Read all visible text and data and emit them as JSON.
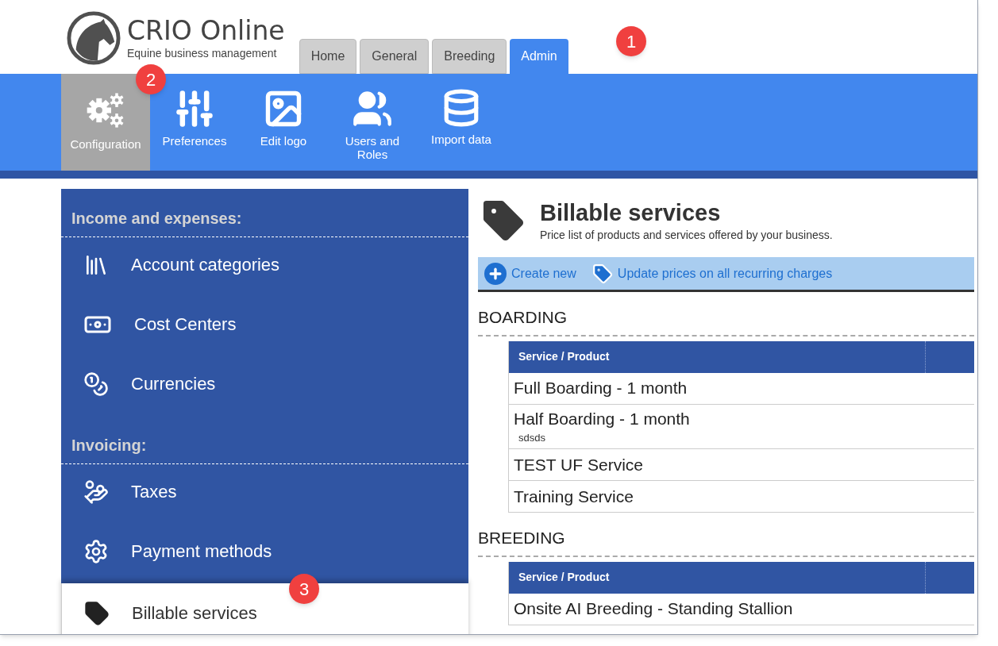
{
  "logo": {
    "title": "CRIO Online",
    "subtitle": "Equine business management"
  },
  "tabs": [
    {
      "label": "Home",
      "selected": false
    },
    {
      "label": "General",
      "selected": false
    },
    {
      "label": "Breeding",
      "selected": false
    },
    {
      "label": "Admin",
      "selected": true
    }
  ],
  "toolbar": [
    {
      "label": "Configuration",
      "selected": true
    },
    {
      "label": "Preferences",
      "selected": false
    },
    {
      "label": "Edit logo",
      "selected": false
    },
    {
      "label": "Users and Roles",
      "selected": false
    },
    {
      "label": "Import data",
      "selected": false
    }
  ],
  "sidebar": {
    "sections": [
      {
        "heading": "Income and expenses:",
        "items": [
          {
            "label": "Account categories",
            "selected": false
          },
          {
            "label": "Cost Centers",
            "selected": false
          },
          {
            "label": "Currencies",
            "selected": false
          }
        ]
      },
      {
        "heading": "Invoicing:",
        "items": [
          {
            "label": "Taxes",
            "selected": false
          },
          {
            "label": "Payment methods",
            "selected": false
          },
          {
            "label": "Billable services",
            "selected": true
          }
        ]
      }
    ]
  },
  "page": {
    "title": "Billable services",
    "subtitle": "Price list of products and services offered by your business.",
    "actions": [
      "Create new",
      "Update prices on all recurring charges"
    ],
    "groups": [
      {
        "heading": "BOARDING",
        "column": "Service / Product",
        "rows": [
          {
            "name": "Full Boarding - 1 month"
          },
          {
            "name": "Half Boarding - 1 month",
            "note": "sdsds"
          },
          {
            "name": "TEST UF Service"
          },
          {
            "name": "Training Service"
          }
        ]
      },
      {
        "heading": "BREEDING",
        "column": "Service / Product",
        "rows": [
          {
            "name": "Onsite AI Breeding - Standing Stallion"
          }
        ]
      }
    ]
  },
  "callouts": [
    "1",
    "2",
    "3"
  ]
}
